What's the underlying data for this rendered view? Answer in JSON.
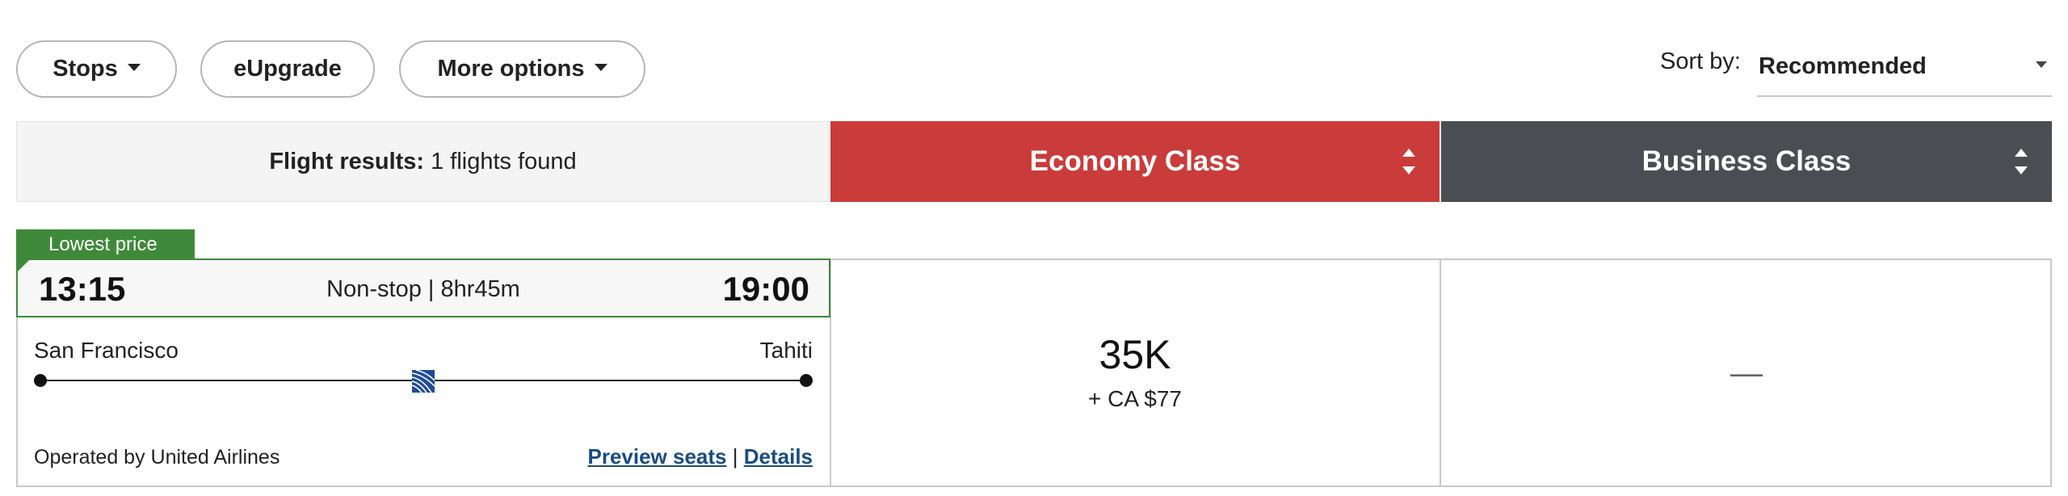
{
  "filters": {
    "stops_label": "Stops",
    "eupgrade_label": "eUpgrade",
    "more_options_label": "More options"
  },
  "sort": {
    "label": "Sort by:",
    "selected": "Recommended"
  },
  "results": {
    "label": "Flight results:",
    "count_text": "1 flights found"
  },
  "cabins": {
    "economy": "Economy Class",
    "business": "Business Class"
  },
  "flight": {
    "badge": "Lowest price",
    "departure_time": "13:15",
    "arrival_time": "19:00",
    "summary": "Non-stop | 8hr45m",
    "origin": "San Francisco",
    "destination": "Tahiti",
    "operated_by": "Operated by United Airlines",
    "preview_seats": "Preview seats",
    "separator": "|",
    "details": "Details",
    "economy_price": "35K",
    "economy_fee": "+ CA $77",
    "business_price": "—"
  },
  "colors": {
    "economy_header": "#c93c3a",
    "business_header": "#4a4d51",
    "badge_green": "#3e8a3a",
    "link_blue": "#1a4c80",
    "airline_logo": "#1f4b99"
  }
}
